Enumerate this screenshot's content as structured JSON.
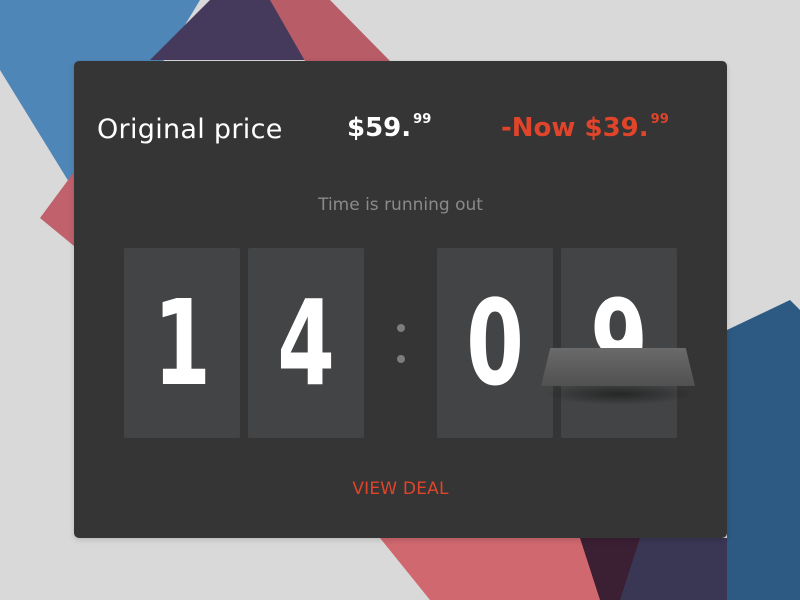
{
  "colors": {
    "background": "#d9d9d9",
    "card": "#343534",
    "tile": "#434445",
    "accent_red": "#e0442a",
    "text_white": "#ffffff",
    "text_muted": "#8a8a8a"
  },
  "pricing": {
    "original_label": "Original price",
    "original_dollars": "$59.",
    "original_cents": "99",
    "sale_prefix": "-Now",
    "sale_dollars": "$39.",
    "sale_cents": "99"
  },
  "timer": {
    "caption": "Time is running out",
    "digits": [
      "1",
      "4",
      "0",
      "9"
    ],
    "separator": ":"
  },
  "cta": {
    "label": "VIEW DEAL"
  }
}
